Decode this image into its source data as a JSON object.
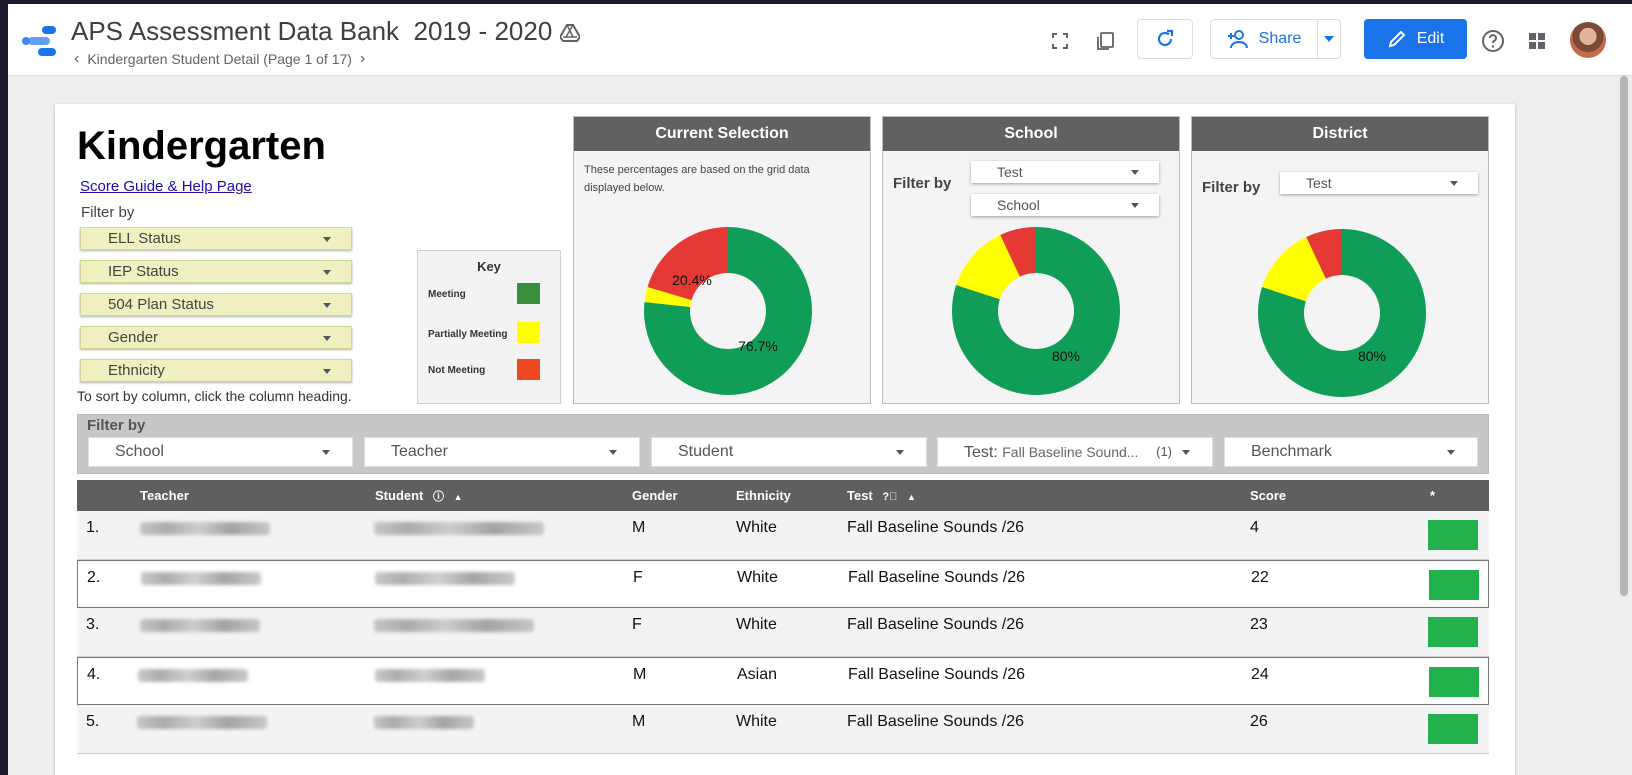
{
  "header": {
    "app_title": "APS Assessment Data Bank  2019 - 2020",
    "breadcrumb": "Kindergarten Student Detail (Page 1 of 17)",
    "share_label": "Share",
    "edit_label": "Edit"
  },
  "report": {
    "title": "Kindergarten",
    "help_link": "Score Guide & Help Page",
    "filter_label": "Filter by",
    "filters": [
      "ELL Status",
      "IEP Status",
      "504 Plan Status",
      "Gender",
      "Ethnicity"
    ],
    "sort_note": "To sort by column, click the column heading."
  },
  "key": {
    "title": "Key",
    "items": [
      {
        "label": "Meeting",
        "color": "#3a8f3f"
      },
      {
        "label": "Partially Meeting",
        "color": "#ffff00"
      },
      {
        "label": "Not Meeting",
        "color": "#ef4a1f"
      }
    ]
  },
  "panels": {
    "current": {
      "title": "Current Selection",
      "note": "These percentages are based on the grid data displayed below.",
      "label_meeting": "76.7%",
      "label_not_meeting": "20.4%"
    },
    "school": {
      "title": "School",
      "filter_label": "Filter by",
      "test_dropdown": "Test",
      "school_dropdown": "School",
      "label_meeting": "80%"
    },
    "district": {
      "title": "District",
      "filter_label": "Filter by",
      "test_dropdown": "Test",
      "label_meeting": "80%"
    }
  },
  "chart_data": [
    {
      "type": "pie",
      "title": "Current Selection",
      "categories": [
        "Meeting",
        "Partially Meeting",
        "Not Meeting"
      ],
      "values": [
        76.7,
        2.9,
        20.4
      ],
      "colors": [
        "#0f9d58",
        "#ffff00",
        "#e53935"
      ]
    },
    {
      "type": "pie",
      "title": "School",
      "categories": [
        "Meeting",
        "Partially Meeting",
        "Not Meeting"
      ],
      "values": [
        80,
        13,
        7
      ],
      "colors": [
        "#0f9d58",
        "#ffff00",
        "#e53935"
      ]
    },
    {
      "type": "pie",
      "title": "District",
      "categories": [
        "Meeting",
        "Partially Meeting",
        "Not Meeting"
      ],
      "values": [
        80,
        13,
        7
      ],
      "colors": [
        "#0f9d58",
        "#ffff00",
        "#e53935"
      ]
    }
  ],
  "filter_bar": {
    "label": "Filter by",
    "school": "School",
    "teacher": "Teacher",
    "student": "Student",
    "test_prefix": "Test:",
    "test_value": "Fall Baseline Sound...",
    "test_count": "(1)",
    "benchmark": "Benchmark"
  },
  "grid": {
    "columns": {
      "teacher": "Teacher",
      "student": "Student",
      "gender": "Gender",
      "ethnicity": "Ethnicity",
      "test": "Test",
      "score": "Score",
      "flag": "*"
    },
    "rows": [
      {
        "num": "1.",
        "gender": "M",
        "ethnicity": "White",
        "test": "Fall Baseline Sounds /26",
        "score": "4",
        "bar_color": "#22b14c"
      },
      {
        "num": "2.",
        "teacher": "Joseph, Virginia",
        "gender": "F",
        "ethnicity": "White",
        "test": "Fall Baseline Sounds /26",
        "score": "22",
        "bar_color": "#22b14c"
      },
      {
        "num": "3.",
        "teacher": "Joseph, Virginia",
        "gender": "F",
        "ethnicity": "White",
        "test": "Fall Baseline Sounds /26",
        "score": "23",
        "bar_color": "#22b14c"
      },
      {
        "num": "4.",
        "gender": "M",
        "ethnicity": "Asian",
        "test": "Fall Baseline Sounds /26",
        "score": "24",
        "bar_color": "#22b14c"
      },
      {
        "num": "5.",
        "gender": "M",
        "ethnicity": "White",
        "test": "Fall Baseline Sounds /26",
        "score": "26",
        "bar_color": "#22b14c"
      }
    ]
  }
}
